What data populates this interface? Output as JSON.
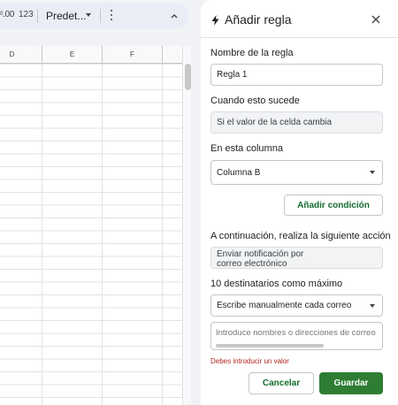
{
  "toolbar": {
    "format_zero_label": ".00",
    "format_zero_prefix": "0",
    "format_number_label": "123",
    "font_label": "Predet...",
    "colors": {
      "toolbar_bg": "#e9eef6"
    }
  },
  "sheet": {
    "columns": [
      "D",
      "E",
      "F"
    ]
  },
  "panel": {
    "title": "Añadir regla",
    "rule_name_label": "Nombre de la regla",
    "rule_name_value": "Regla 1",
    "trigger_label": "Cuando esto sucede",
    "trigger_value": "Si el valor de la celda cambia",
    "column_label": "En esta columna",
    "column_value": "Columna B",
    "add_condition_label": "Añadir condición",
    "action_label": "A continuación, realiza la siguiente acción",
    "action_value": "Enviar notificación por correo electrónico",
    "recipients_label": "10 destinatarios como máximo",
    "recipients_mode_value": "Escribe manualmente cada correo",
    "recipients_placeholder": "Introduce nombres o direcciones de correo",
    "error_text": "Debes introducir un valor",
    "cancel_label": "Cancelar",
    "save_label": "Guardar",
    "colors": {
      "accent": "#146c2e",
      "primary_button": "#2e7d32",
      "error": "#b3261e"
    }
  }
}
